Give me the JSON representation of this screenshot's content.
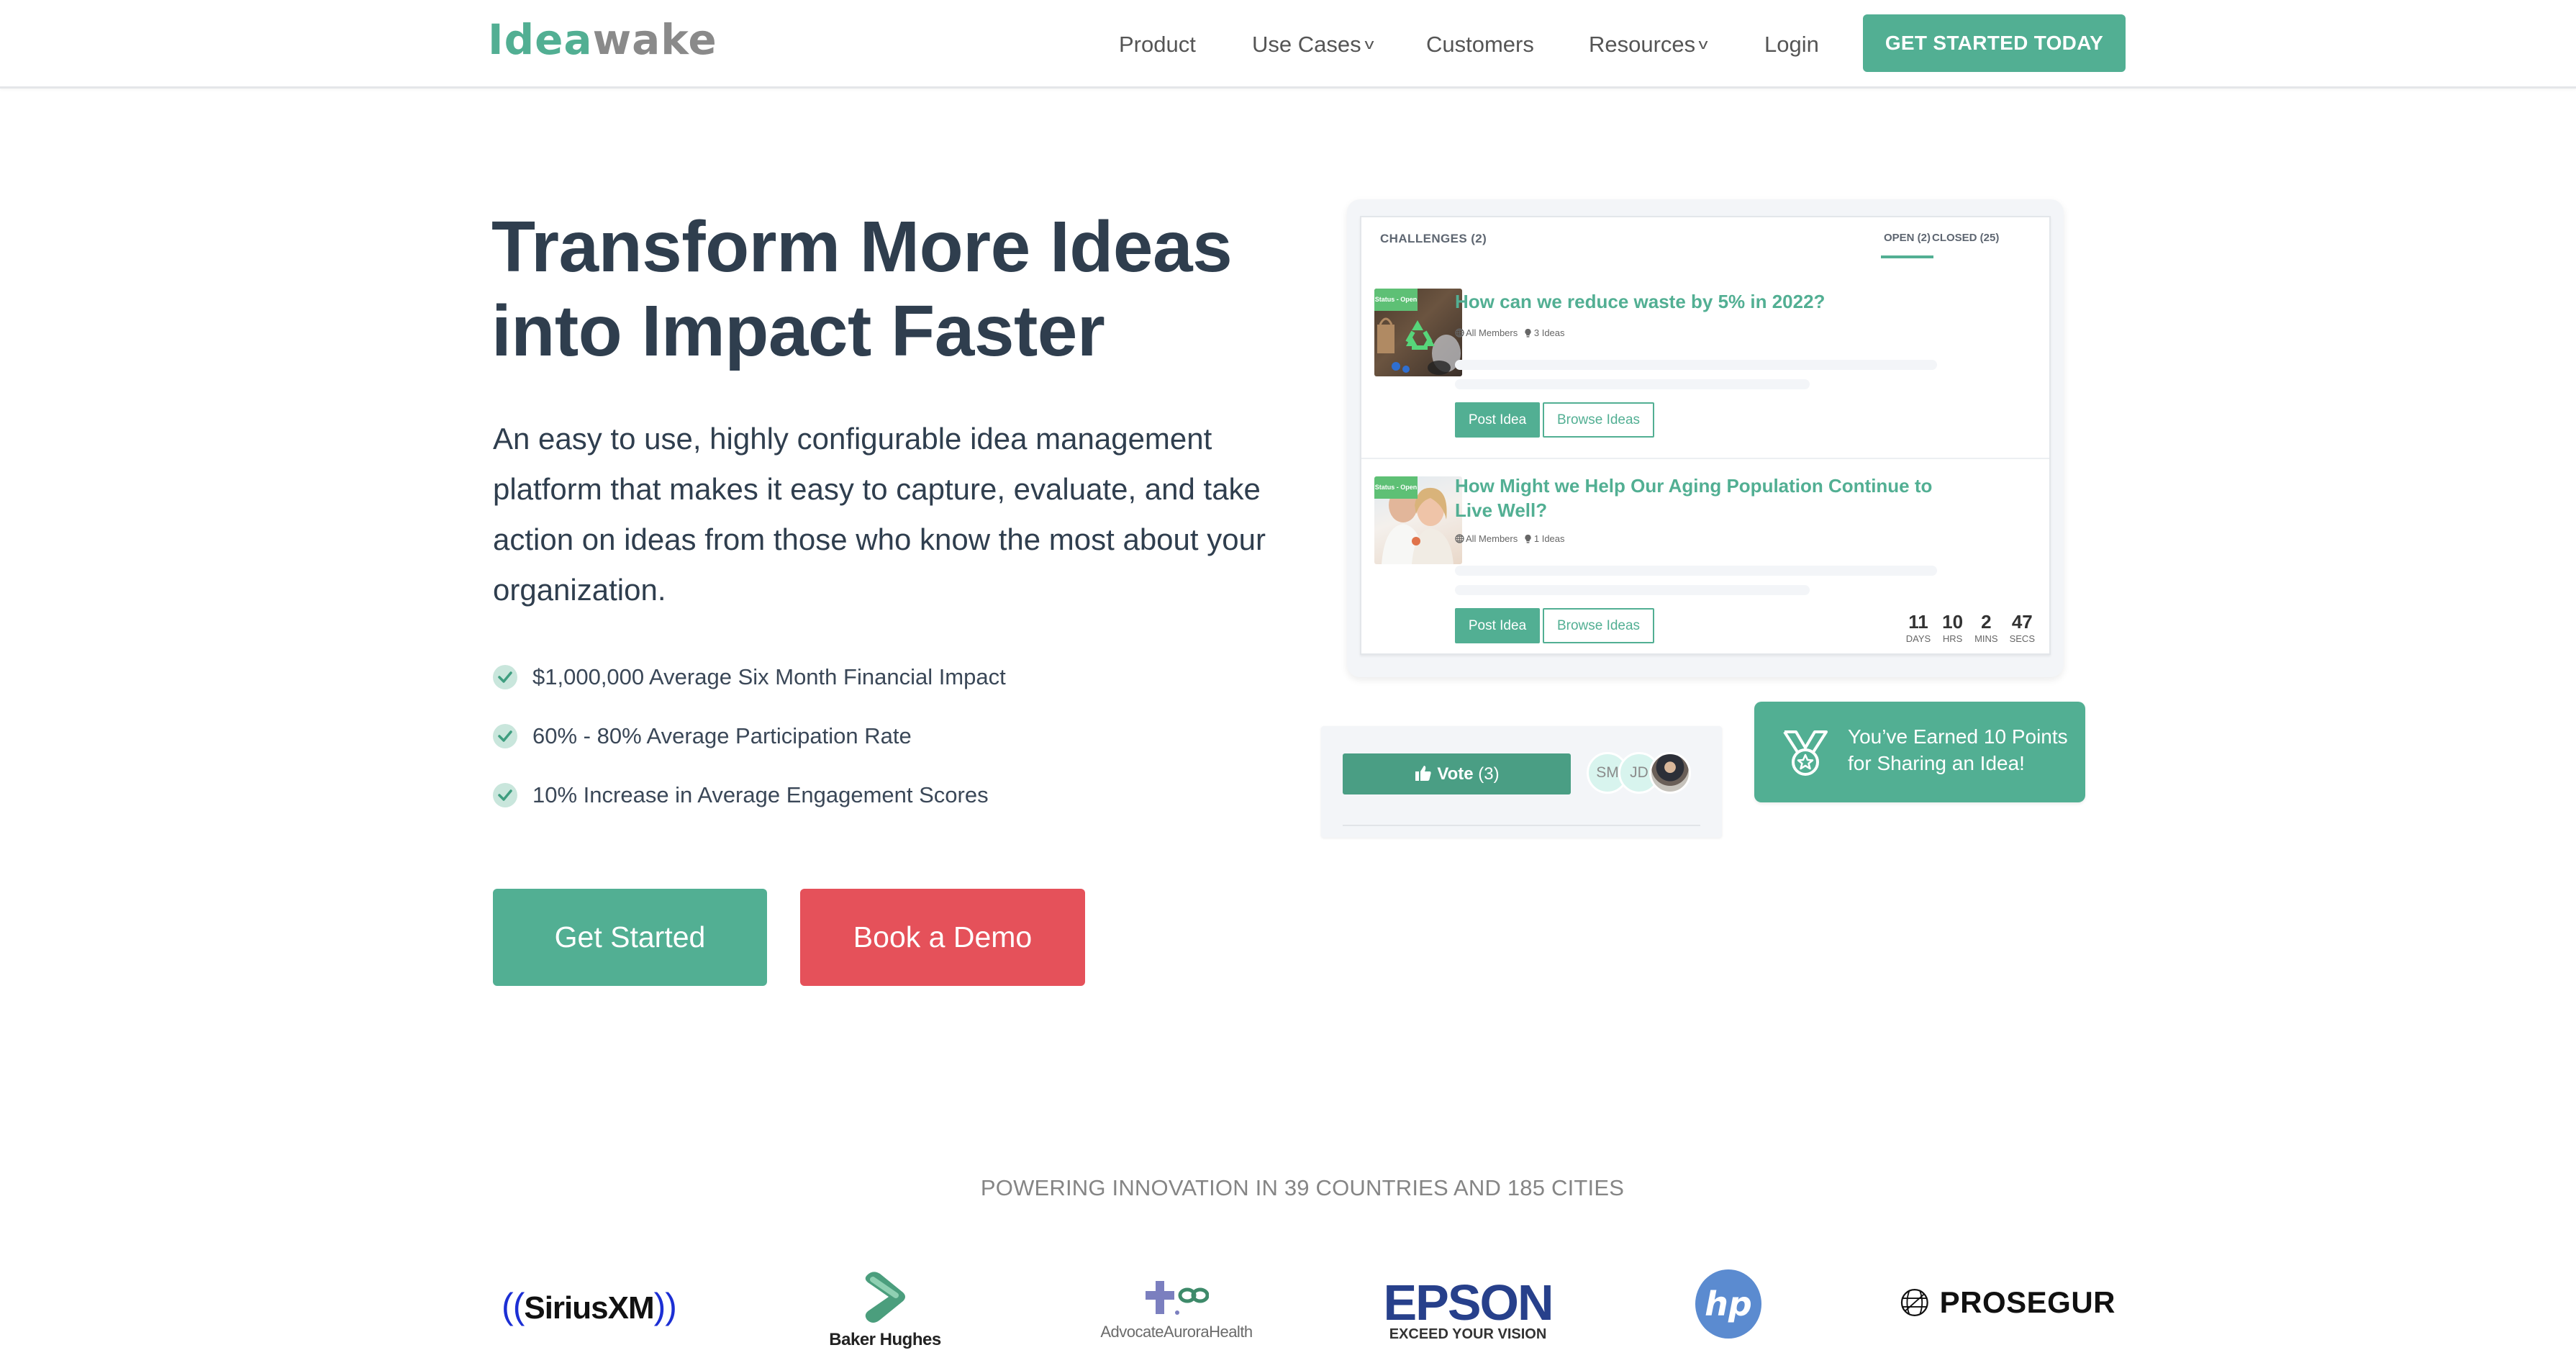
{
  "nav": {
    "logo": {
      "part1": "Idea",
      "part2": "wake"
    },
    "items": [
      {
        "label": "Product",
        "has_dropdown": false
      },
      {
        "label": "Use Cases",
        "has_dropdown": true
      },
      {
        "label": "Customers",
        "has_dropdown": false
      },
      {
        "label": "Resources",
        "has_dropdown": true
      },
      {
        "label": "Login",
        "has_dropdown": false
      }
    ],
    "cta_label": "GET STARTED TODAY",
    "chevron_glyph": "v"
  },
  "hero": {
    "headline_line1": "Transform More Ideas",
    "headline_line2": "into Impact Faster",
    "lead": "An easy to use, highly configurable idea management platform that makes it easy to capture, evaluate, and take action on ideas from those who know the most about your organization.",
    "bullets": [
      "$1,000,000 Average Six Month Financial Impact",
      "60% - 80% Average Participation Rate",
      "10% Increase in Average Engagement Scores"
    ],
    "primary_button": "Get Started",
    "secondary_button": "Book a Demo"
  },
  "challenge_card": {
    "title": "CHALLENGES (2)",
    "tabs": [
      {
        "label": "OPEN (2)",
        "active": true
      },
      {
        "label": "CLOSED (25)",
        "active": false
      }
    ],
    "challenges": [
      {
        "status": "Status - Open",
        "title": "How can we reduce waste by 5% in 2022?",
        "audience": "All Members",
        "ideas": "3 Ideas",
        "image_icon": "recycle-icon",
        "post_label": "Post Idea",
        "browse_label": "Browse Ideas"
      },
      {
        "status": "Status - Open",
        "title": "How Might we Help Our Aging Population Continue to Live Well?",
        "audience": "All Members",
        "ideas": "1 Ideas",
        "image_icon": "couple-photo",
        "post_label": "Post Idea",
        "browse_label": "Browse Ideas",
        "countdown": [
          {
            "value": "11",
            "unit": "DAYS"
          },
          {
            "value": "10",
            "unit": "HRS"
          },
          {
            "value": "2",
            "unit": "MINS"
          },
          {
            "value": "47",
            "unit": "SECS"
          }
        ]
      }
    ]
  },
  "vote_panel": {
    "vote_label": "Vote",
    "vote_count": "(3)",
    "avatars": [
      "SM",
      "JD"
    ]
  },
  "points_card": {
    "text": "You’ve Earned 10 Points for Sharing an Idea!"
  },
  "social_proof": {
    "heading": "POWERING INNOVATION IN 39 COUNTRIES AND 185 CITIES",
    "logos": {
      "siriusxm": "SiriusXM",
      "baker_hughes": "Baker Hughes",
      "advocate": "AdvocateAuroraHealth",
      "epson": "EPSON",
      "epson_tagline": "EXCEED YOUR VISION",
      "hp": "hp",
      "prosegur": "PROSEGUR"
    }
  },
  "colors": {
    "brand_green": "#52af93",
    "vote_green": "#4a9e84",
    "demo_red": "#e5515a",
    "status_green": "#5ec075",
    "heading_dark": "#2f3e4e"
  }
}
